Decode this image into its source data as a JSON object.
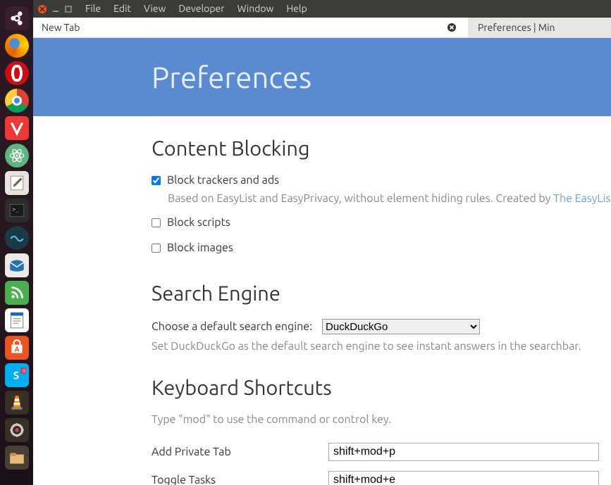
{
  "menubar": {
    "items": [
      "File",
      "Edit",
      "View",
      "Developer",
      "Window",
      "Help"
    ]
  },
  "tabs": {
    "tab1": "New Tab",
    "tab2": "Preferences | Min"
  },
  "hero": {
    "title": "Preferences"
  },
  "sections": {
    "content_blocking": {
      "title": "Content Blocking",
      "block_trackers": {
        "label": "Block trackers and ads",
        "checked": true
      },
      "block_trackers_sub_pre": "Based on EasyList and EasyPrivacy, without element hiding rules. Created by ",
      "block_trackers_sub_link": "The EasyLis",
      "block_scripts": {
        "label": "Block scripts",
        "checked": false
      },
      "block_images": {
        "label": "Block images",
        "checked": false
      }
    },
    "search_engine": {
      "title": "Search Engine",
      "label": "Choose a default search engine:",
      "value": "DuckDuckGo",
      "sub": "Set DuckDuckGo as the default search engine to see instant answers in the searchbar."
    },
    "keyboard": {
      "title": "Keyboard Shortcuts",
      "sub": "Type \"mod\" to use the command or control key.",
      "rows": {
        "add_private_tab": {
          "label": "Add Private Tab",
          "value": "shift+mod+p"
        },
        "toggle_tasks": {
          "label": "Toggle Tasks",
          "value": "shift+mod+e"
        }
      }
    }
  },
  "launcher": {
    "items": [
      "ubuntu-dash",
      "firefox",
      "opera",
      "chrome",
      "vivaldi",
      "atom",
      "text-editor",
      "terminal",
      "min-browser",
      "thunderbird",
      "rss-reader",
      "libreoffice-writer",
      "ubuntu-software",
      "skype",
      "vlc",
      "settings-tool",
      "files"
    ]
  }
}
